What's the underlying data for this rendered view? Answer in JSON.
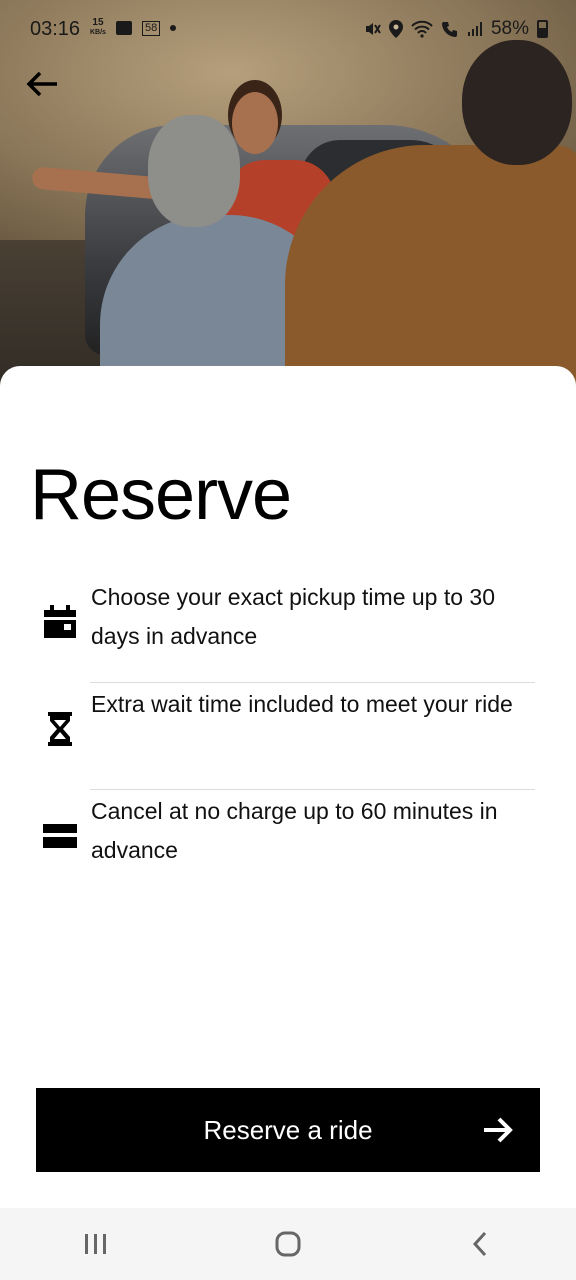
{
  "status_bar": {
    "time": "03:16",
    "speed_value": "15",
    "speed_unit": "KB/s",
    "notif_count": "58",
    "battery": "58%"
  },
  "header": {
    "back_icon": "arrow-left-icon"
  },
  "sheet": {
    "title": "Reserve",
    "features": [
      {
        "icon": "calendar-icon",
        "text": "Choose your exact pickup time up to 30 days in advance"
      },
      {
        "icon": "hourglass-icon",
        "text": "Extra wait time included to meet your ride"
      },
      {
        "icon": "card-icon",
        "text": "Cancel at no charge up to 60 minutes in advance"
      }
    ],
    "cta_label": "Reserve a ride"
  },
  "colors": {
    "button_bg": "#000000",
    "button_text": "#ffffff",
    "divider": "#dcdcdc"
  }
}
